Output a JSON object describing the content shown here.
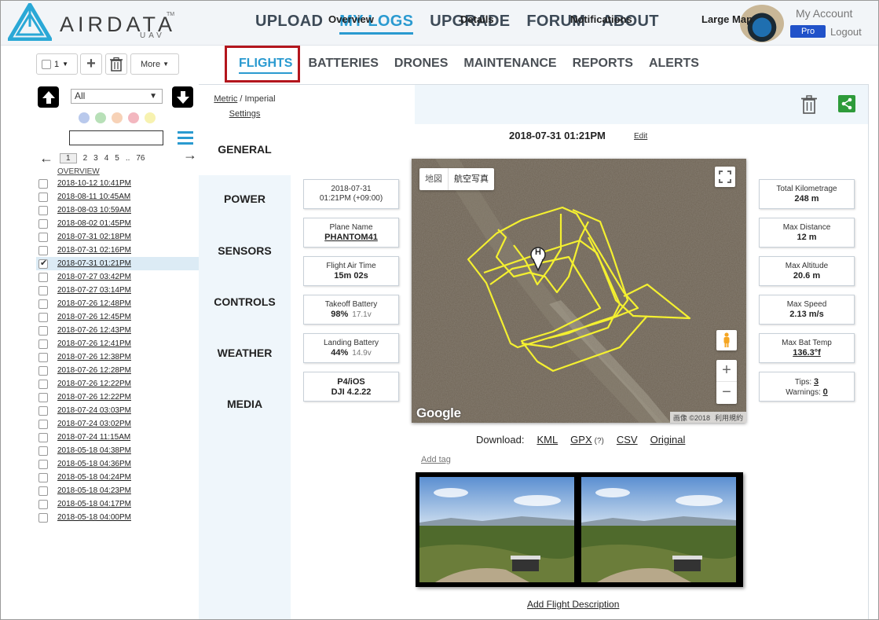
{
  "brand": {
    "name": "AIRDATA",
    "sub": "UAV",
    "tm": "TM"
  },
  "nav": {
    "items": [
      "UPLOAD",
      "MY LOGS",
      "UPGRADE",
      "FORUM",
      "ABOUT"
    ],
    "active": "MY LOGS"
  },
  "account": {
    "label": "My Account",
    "badge": "Pro",
    "logout": "Logout"
  },
  "toolbar": {
    "select_count": "1",
    "more_label": "More"
  },
  "subnav": {
    "items": [
      "FLIGHTS",
      "BATTERIES",
      "DRONES",
      "MAINTENANCE",
      "REPORTS",
      "ALERTS"
    ],
    "active": "FLIGHTS"
  },
  "filter": {
    "selected": "All"
  },
  "pager": {
    "current": "1",
    "pages": [
      "2",
      "3",
      "4",
      "5"
    ],
    "ellipsis": "..",
    "last": "76"
  },
  "logs": {
    "overview_label": "OVERVIEW",
    "items": [
      "2018-10-12 10:41PM",
      "2018-08-11 10:45AM",
      "2018-08-03 10:59AM",
      "2018-08-02 01:45PM",
      "2018-07-31 02:18PM",
      "2018-07-31 02:16PM",
      "2018-07-31 01:21PM",
      "2018-07-27 03:42PM",
      "2018-07-27 03:14PM",
      "2018-07-26 12:48PM",
      "2018-07-26 12:45PM",
      "2018-07-26 12:43PM",
      "2018-07-26 12:41PM",
      "2018-07-26 12:38PM",
      "2018-07-26 12:28PM",
      "2018-07-26 12:22PM",
      "2018-07-26 12:22PM",
      "2018-07-24 03:03PM",
      "2018-07-24 03:02PM",
      "2018-07-24 11:15AM",
      "2018-05-18 04:38PM",
      "2018-05-18 04:36PM",
      "2018-05-18 04:24PM",
      "2018-05-18 04:23PM",
      "2018-05-18 04:17PM",
      "2018-05-18 04:00PM"
    ],
    "selected_index": 6
  },
  "units": {
    "metric": "Metric",
    "sep": " / ",
    "imperial": "Imperial",
    "settings": "Settings"
  },
  "categories": [
    "GENERAL",
    "POWER",
    "SENSORS",
    "CONTROLS",
    "WEATHER",
    "MEDIA"
  ],
  "tabs": [
    "Overview",
    "Details",
    "Notifications",
    "Large Map"
  ],
  "flight": {
    "title": "2018-07-31 01:21PM",
    "edit": "Edit",
    "date_line1": "2018-07-31",
    "date_line2": "01:21PM (+09:00)",
    "plane_label": "Plane Name",
    "plane_value": "PHANTOM41",
    "air_label": "Flight Air Time",
    "air_value": "15m 02s",
    "takeoff_label": "Takeoff Battery",
    "takeoff_value": "98%",
    "takeoff_volt": "17.1v",
    "landing_label": "Landing Battery",
    "landing_value": "44%",
    "landing_volt": "14.9v",
    "platform_line1": "P4/iOS",
    "platform_line2": "DJI 4.2.22",
    "km_label": "Total Kilometrage",
    "km_value": "248 m",
    "dist_label": "Max Distance",
    "dist_value": "12 m",
    "alt_label": "Max Altitude",
    "alt_value": "20.6 m",
    "speed_label": "Max Speed",
    "speed_value": "2.13 m/s",
    "temp_label": "Max Bat Temp",
    "temp_value": "136.3°f",
    "tips_label": "Tips:",
    "tips_value": "3",
    "warn_label": "Warnings:",
    "warn_value": "0"
  },
  "map": {
    "type_map": "地図",
    "type_sat": "航空写真",
    "google": "Google",
    "copyright": "画像 ©2018",
    "terms": "利用規約",
    "home_marker": "H"
  },
  "downloads": {
    "label": "Download:",
    "kml": "KML",
    "gpx": "GPX",
    "gpx_help": "(?)",
    "csv": "CSV",
    "original": "Original"
  },
  "add_tag": "Add tag",
  "add_description": "Add Flight Description",
  "colors": {
    "accent": "#2a9ad0",
    "highlight": "#b3161d",
    "pro": "#2152c9",
    "share": "#2e9b3a",
    "track": "#f4f030"
  },
  "filter_dots": [
    "#b9c9ec",
    "#b8e0b8",
    "#f7d2b7",
    "#f3b7bf",
    "#f7f2b0"
  ]
}
